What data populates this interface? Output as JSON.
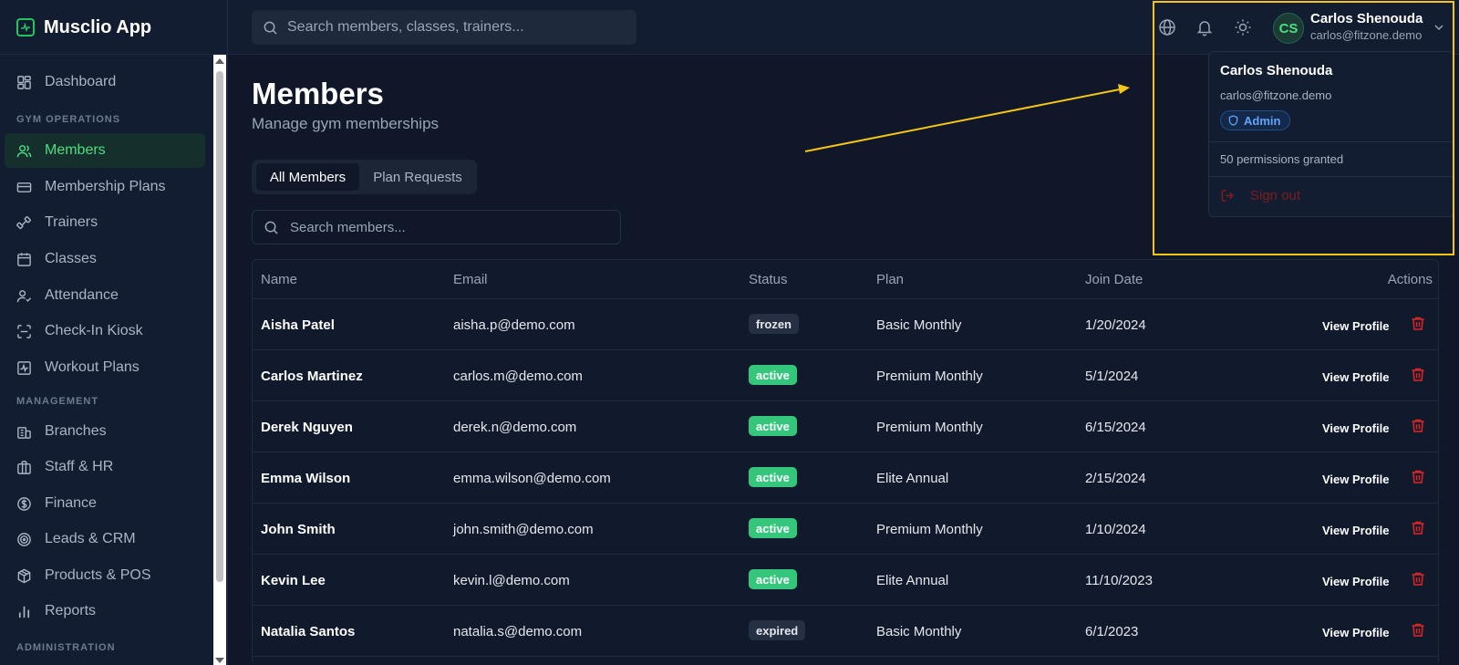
{
  "app": {
    "name": "Musclio App",
    "accent": "#22c55e"
  },
  "sidebar": {
    "dashboard": "Dashboard",
    "section_gym": "GYM OPERATIONS",
    "gym_items": [
      "Members",
      "Membership Plans",
      "Trainers",
      "Classes",
      "Attendance",
      "Check-In Kiosk",
      "Workout Plans"
    ],
    "section_management": "MANAGEMENT",
    "management_items": [
      "Branches",
      "Staff & HR",
      "Finance",
      "Leads & CRM",
      "Products & POS",
      "Reports"
    ],
    "section_admin": "ADMINISTRATION",
    "active_item": "Members"
  },
  "topbar": {
    "search_placeholder": "Search members, classes, trainers...",
    "icons": [
      "globe-icon",
      "bell-icon",
      "sun-icon"
    ],
    "user": {
      "initials": "CS",
      "name": "Carlos Shenouda",
      "email": "carlos@fitzone.demo"
    }
  },
  "user_menu": {
    "name": "Carlos Shenouda",
    "email": "carlos@fitzone.demo",
    "role": "Admin",
    "permissions": "50 permissions granted",
    "sign_out": "Sign out"
  },
  "main": {
    "title": "Members",
    "subtitle": "Manage gym memberships",
    "tabs": [
      "All Members",
      "Plan Requests"
    ],
    "active_tab": "All Members",
    "search_placeholder": "Search members..."
  },
  "table": {
    "headers": [
      "Name",
      "Email",
      "Status",
      "Plan",
      "Join Date",
      "Actions"
    ],
    "action_label": "View Profile",
    "rows": [
      {
        "name": "Aisha Patel",
        "email": "aisha.p@demo.com",
        "status": "frozen",
        "plan": "Basic Monthly",
        "join_date": "1/20/2024"
      },
      {
        "name": "Carlos Martinez",
        "email": "carlos.m@demo.com",
        "status": "active",
        "plan": "Premium Monthly",
        "join_date": "5/1/2024"
      },
      {
        "name": "Derek Nguyen",
        "email": "derek.n@demo.com",
        "status": "active",
        "plan": "Premium Monthly",
        "join_date": "6/15/2024"
      },
      {
        "name": "Emma Wilson",
        "email": "emma.wilson@demo.com",
        "status": "active",
        "plan": "Elite Annual",
        "join_date": "2/15/2024"
      },
      {
        "name": "John Smith",
        "email": "john.smith@demo.com",
        "status": "active",
        "plan": "Premium Monthly",
        "join_date": "1/10/2024"
      },
      {
        "name": "Kevin Lee",
        "email": "kevin.l@demo.com",
        "status": "active",
        "plan": "Elite Annual",
        "join_date": "11/10/2023"
      },
      {
        "name": "Natalia Santos",
        "email": "natalia.s@demo.com",
        "status": "expired",
        "plan": "Basic Monthly",
        "join_date": "6/1/2023"
      }
    ]
  },
  "colors": {
    "active_badge": "#34c77b",
    "danger": "#dc2626",
    "highlight": "#f5c518",
    "role_badge": "#60a5fa"
  }
}
